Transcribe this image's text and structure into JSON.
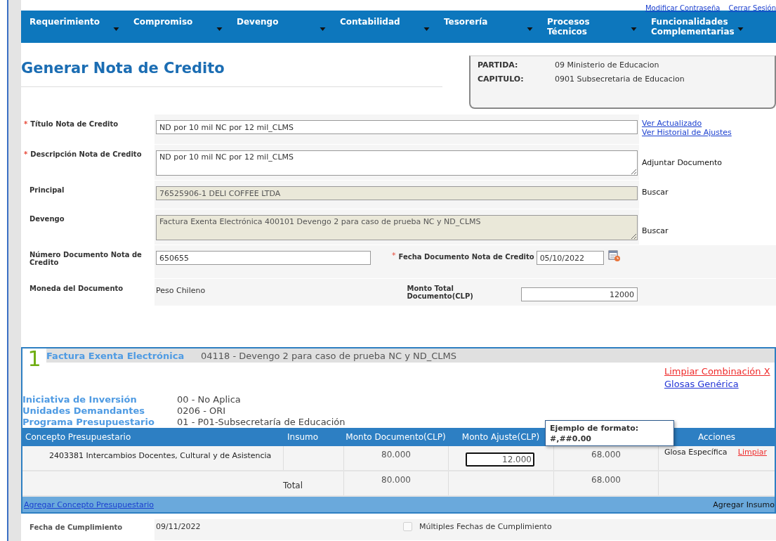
{
  "top_links": [
    "Modificar Contraseña",
    "Cerrar Sesión"
  ],
  "menu": [
    {
      "label": "Requerimiento"
    },
    {
      "label": "Compromiso"
    },
    {
      "label": "Devengo"
    },
    {
      "label": "Contabilidad"
    },
    {
      "label": "Tesorería"
    },
    {
      "label": "Procesos Técnicos"
    },
    {
      "label": "Funcionalidades Complementarias"
    }
  ],
  "page_title": "Generar Nota de Credito",
  "info_box": [
    {
      "label": "PARTIDA:",
      "value": "09 Ministerio de Educacion"
    },
    {
      "label": "CAPITULO:",
      "value": "0901 Subsecretaria de Educacion"
    }
  ],
  "form": {
    "titulo": {
      "label": "Título Nota de Credito",
      "marker": "*",
      "value": "ND por 10 mil NC por 12 mil_CLMS",
      "links": [
        "Ver Actualizado",
        "Ver Historial de Ajustes"
      ]
    },
    "descripcion": {
      "label": "Descripción Nota de Credito",
      "marker": "*",
      "value": "ND por 10 mil NC por 12 mil_CLMS",
      "action": "Adjuntar Documento"
    },
    "principal": {
      "label": "Principal",
      "value": "76525906-1 DELI COFFEE LTDA",
      "disabled": true,
      "action": "Buscar"
    },
    "devengo": {
      "label": "Devengo",
      "value": "Factura Exenta Electrónica 400101 Devengo 2 para caso de prueba NC y ND_CLMS",
      "disabled": true,
      "action": "Buscar"
    },
    "numero": {
      "label": "Número Documento Nota de Credito",
      "value": "650655"
    },
    "fecha": {
      "label": "Fecha Documento Nota de Credito",
      "marker": "*",
      "value": "05/10/2022"
    },
    "moneda": {
      "label": "Moneda del Documento",
      "value": "Peso Chileno"
    },
    "monto_total": {
      "label": "Monto Total Documento(CLP)",
      "value": "12000"
    }
  },
  "section": {
    "number": "1",
    "doc_type": "Factura Exenta Electrónica",
    "doc_title": "04118 - Devengo 2 para caso de prueba NC y ND_CLMS",
    "links": [
      {
        "label": "Limpiar Combinación X",
        "kind": "danger"
      },
      {
        "label": "Glosas Genérica",
        "kind": "normal"
      }
    ],
    "details": [
      {
        "label": "Iniciativa de Inversión",
        "value": "00 - No Aplica"
      },
      {
        "label": "Unidades Demandantes",
        "value": "0206 - ORI"
      },
      {
        "label": "Programa Presupuestario",
        "value": "01 - P01-Subsecretaría de Educación"
      }
    ],
    "table": {
      "columns": [
        "Concepto Presupuestario",
        "Insumo",
        "Monto Documento(CLP)",
        "Monto Ajuste(CLP)",
        "",
        "Acciones"
      ],
      "rows": [
        {
          "concepto": "2403381 Intercambios Docentes, Cultural y de Asistencia",
          "monto_documento": "80.000",
          "monto_ajuste": "12.000",
          "column_5": "68.000",
          "glosa": "Glosa Específica",
          "limpiar": "Limpiar"
        }
      ],
      "total": {
        "label": "Total",
        "monto_documento": "80.000",
        "column_5": "68.000"
      }
    },
    "tooltip": [
      "Ejemplo de formato:",
      "#,##0.00"
    ],
    "footer": {
      "link": "Agregar Concepto Presupuestario",
      "action": "Agregar Insumo"
    }
  },
  "cumplimiento": {
    "label": "Fecha de Cumplimiento",
    "value": "09/11/2022",
    "multiple": {
      "label": "Múltiples Fechas de Cumplimiento",
      "checked": false,
      "disabled": true
    }
  }
}
